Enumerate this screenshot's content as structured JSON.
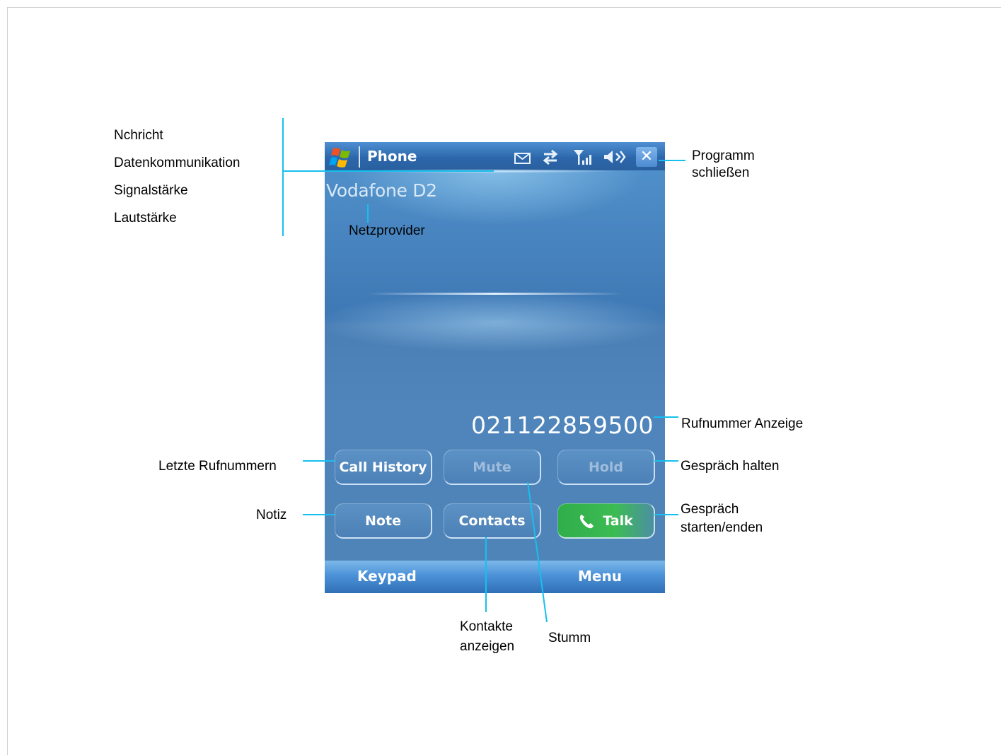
{
  "annotations": {
    "nachricht": "Nchricht",
    "datenkommunikation": "Datenkommunikation",
    "signalstaerke": "Signalstärke",
    "lautstaerke": "Lautstärke",
    "programm_line1": "Programm",
    "programm_line2": "schließen",
    "netzprovider": "Netzprovider",
    "rufnummer_anzeige": "Rufnummer Anzeige",
    "letzte_rufnummern": "Letzte Rufnummern",
    "gespraech_halten": "Gespräch halten",
    "notiz": "Notiz",
    "gespraech_line1": "Gespräch",
    "gespraech_line2": "starten/enden",
    "kontakte_line1": "Kontakte",
    "kontakte_line2": "anzeigen",
    "stumm": "Stumm"
  },
  "phone": {
    "title": "Phone",
    "provider": "Vodafone D2",
    "number": "021122859500",
    "close_label": "✕",
    "buttons": {
      "call_history": "Call History",
      "mute": "Mute",
      "hold": "Hold",
      "note": "Note",
      "contacts": "Contacts",
      "talk": "Talk"
    },
    "softkeys": {
      "left": "Keypad",
      "right": "Menu"
    },
    "status_icons": [
      "envelope-icon",
      "data-arrows-icon",
      "signal-strength-icon",
      "speaker-volume-icon"
    ]
  },
  "colors": {
    "callout_line": "#16c0ee",
    "screen_blue": "#3f74ad",
    "talk_green": "#2fae4a"
  }
}
